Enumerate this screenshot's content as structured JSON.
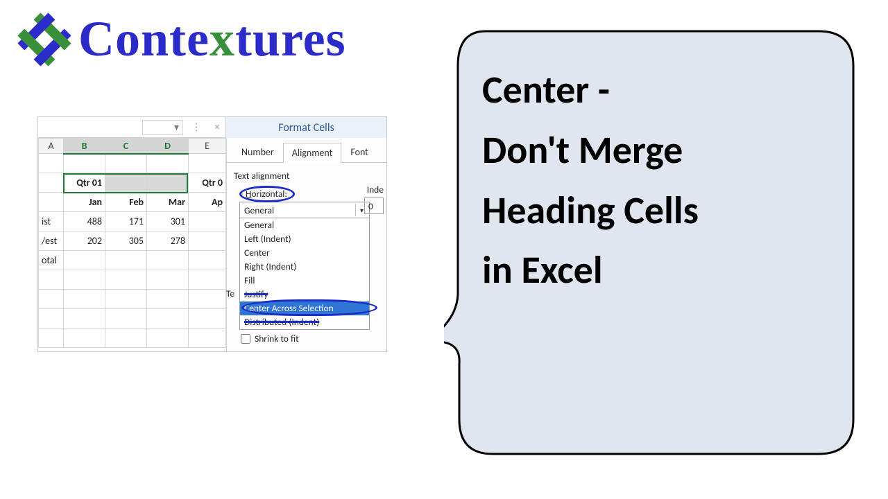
{
  "brand": {
    "prefix": "Conte",
    "x": "x",
    "suffix": "tures"
  },
  "excel": {
    "dialog_title": "Format Cells",
    "dropdown_caret": "▾",
    "close_glyph": "×",
    "col_headers": [
      "A",
      "B",
      "C",
      "D",
      "E"
    ],
    "qtr": {
      "b": "Qtr 01",
      "e": "Qtr 0"
    },
    "months": {
      "b": "Jan",
      "c": "Feb",
      "d": "Mar",
      "e": "Ap"
    },
    "rows": [
      {
        "label": "ist",
        "b": "488",
        "c": "171",
        "d": "301"
      },
      {
        "label": "/est",
        "b": "202",
        "c": "305",
        "d": "278"
      },
      {
        "label": "otal",
        "b": "",
        "c": "",
        "d": ""
      }
    ],
    "tabs": {
      "number": "Number",
      "alignment": "Alignment",
      "font": "Font"
    },
    "section": "Text alignment",
    "horiz_label": "Horizontal:",
    "combo_value": "General",
    "options": [
      "General",
      "Left (Indent)",
      "Center",
      "Right (Indent)",
      "Fill",
      "Justify",
      "Center Across Selection",
      "Distributed (Indent)"
    ],
    "shrink": "Shrink to fit",
    "indent_label": "Inde",
    "indent_value": "0",
    "te_prefix": "Te"
  },
  "bubble": {
    "line1": "Center -",
    "line2": "Don't Merge",
    "line3": "Heading Cells",
    "line4": "in Excel"
  }
}
